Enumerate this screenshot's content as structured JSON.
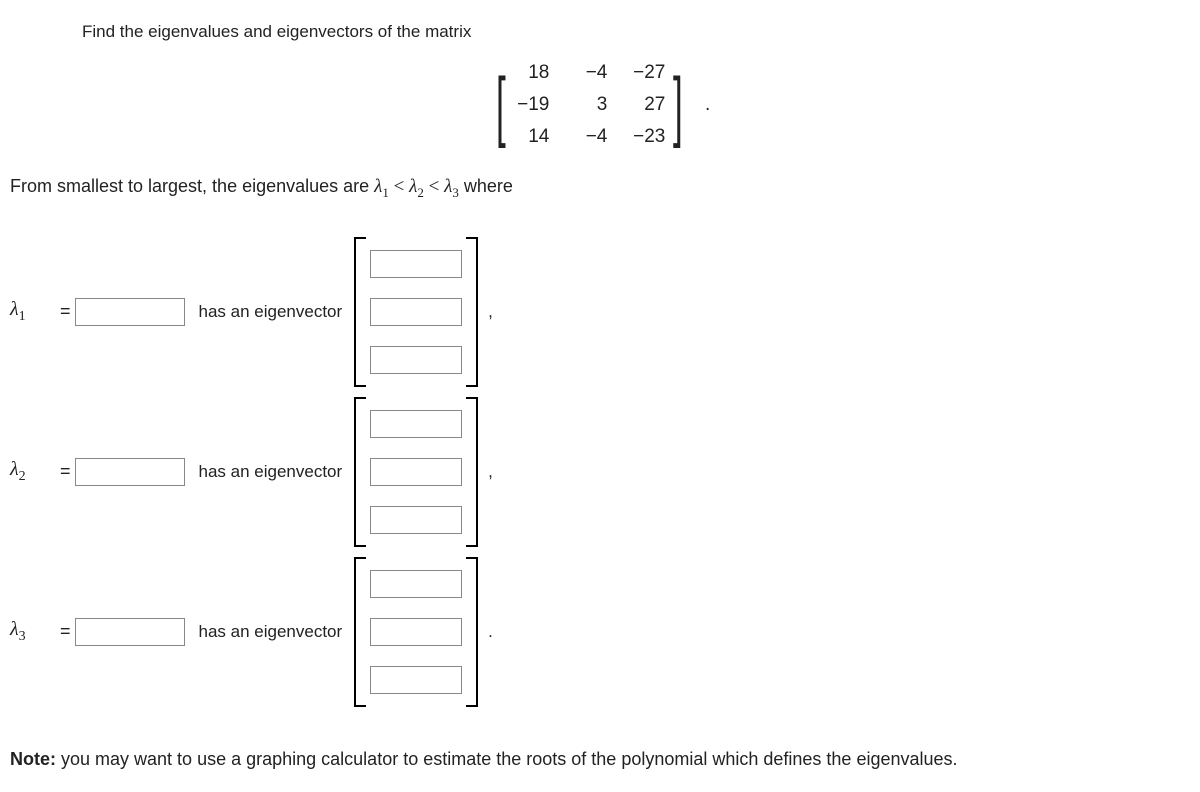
{
  "question_text": "Find the eigenvalues and eigenvectors of the matrix",
  "matrix": {
    "rows": [
      [
        "18",
        "−4",
        "−27"
      ],
      [
        "−19",
        "3",
        "27"
      ],
      [
        "14",
        "−4",
        "−23"
      ]
    ]
  },
  "ordering_text": {
    "prefix": "From smallest to largest, the eigenvalues are ",
    "l1": "λ",
    "s1": "1",
    "lt": " < ",
    "l2": "λ",
    "s2": "2",
    "l3": "λ",
    "s3": "3",
    "suffix": " where"
  },
  "rows": [
    {
      "label": "λ",
      "sub": "1",
      "eq": "=",
      "text": "has an eigenvector",
      "punct": ","
    },
    {
      "label": "λ",
      "sub": "2",
      "eq": "=",
      "text": "has an eigenvector",
      "punct": ","
    },
    {
      "label": "λ",
      "sub": "3",
      "eq": "=",
      "text": "has an eigenvector",
      "punct": "."
    }
  ],
  "note": {
    "bold": "Note:",
    "rest": " you may want to use a graphing calculator to estimate the roots of the polynomial which defines the eigenvalues."
  }
}
